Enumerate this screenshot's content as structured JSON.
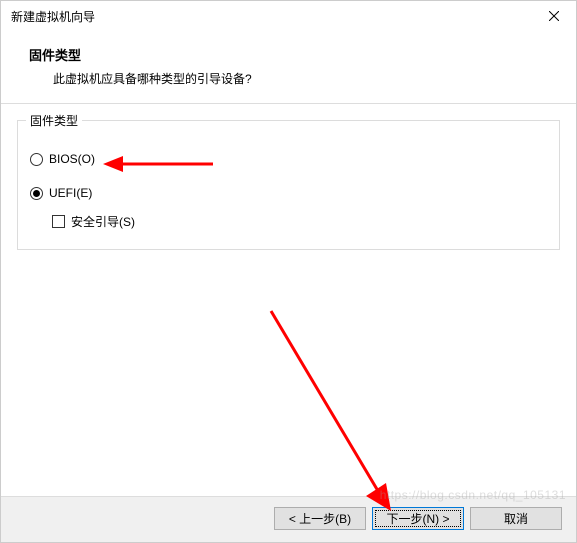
{
  "titlebar": {
    "title": "新建虚拟机向导"
  },
  "header": {
    "heading": "固件类型",
    "subheading": "此虚拟机应具备哪种类型的引导设备?"
  },
  "group": {
    "legend": "固件类型",
    "bios_label": "BIOS(O)",
    "uefi_label": "UEFI(E)",
    "secureboot_label": "安全引导(S)",
    "selected": "uefi",
    "secureboot_checked": false
  },
  "buttons": {
    "back": "< 上一步(B)",
    "next": "下一步(N) >",
    "cancel": "取消"
  },
  "watermark": "https://blog.csdn.net/qq_105131"
}
